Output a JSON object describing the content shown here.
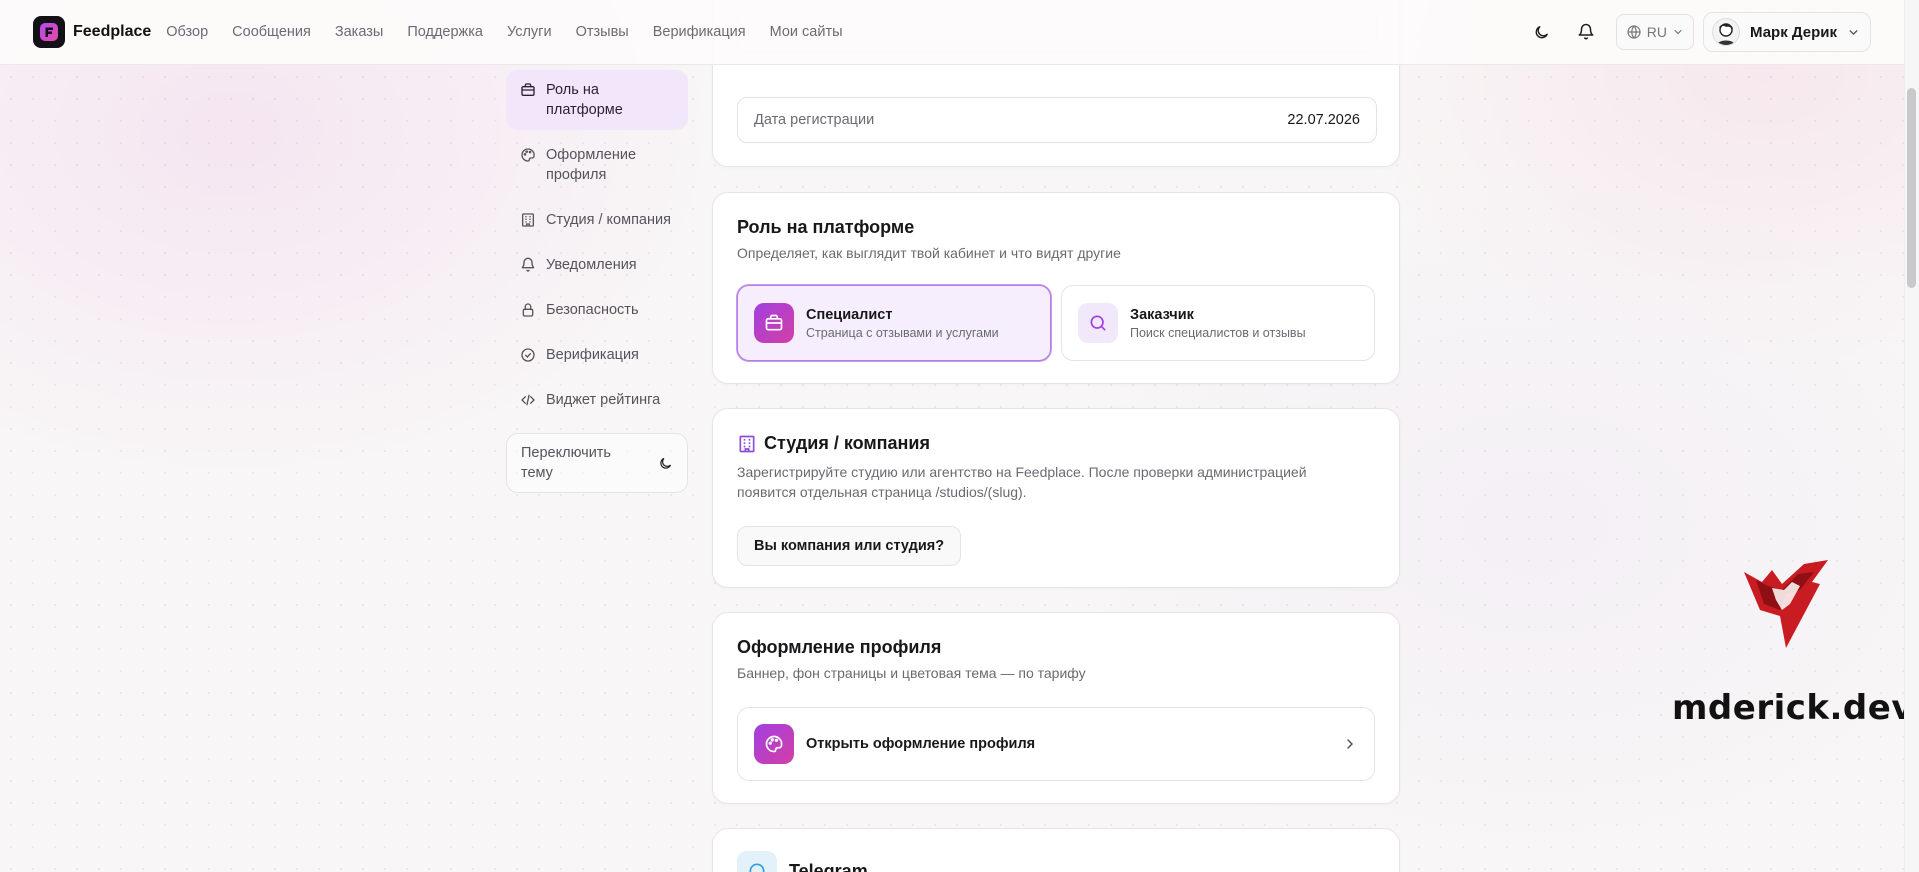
{
  "brand": {
    "name": "Feedplace"
  },
  "nav": [
    "Обзор",
    "Сообщения",
    "Заказы",
    "Поддержка",
    "Услуги",
    "Отзывы",
    "Верификация",
    "Мои сайты"
  ],
  "header": {
    "language": "RU",
    "user_name": "Марк Дерик"
  },
  "sidebar": {
    "items": [
      {
        "label": "Роль на платформе",
        "icon": "briefcase-icon",
        "active": true
      },
      {
        "label": "Оформление профиля",
        "icon": "palette-icon"
      },
      {
        "label": "Студия / компания",
        "icon": "building-icon"
      },
      {
        "label": "Уведомления",
        "icon": "bell-icon"
      },
      {
        "label": "Безопасность",
        "icon": "lock-icon"
      },
      {
        "label": "Верификация",
        "icon": "check-circle-icon"
      },
      {
        "label": "Виджет рейтинга",
        "icon": "code-icon"
      }
    ],
    "theme_toggle": "Переключить тему"
  },
  "account": {
    "reg_label": "Дата регистрации",
    "reg_date": "22.07.2026"
  },
  "role": {
    "title": "Роль на платформе",
    "subtitle": "Определяет, как выглядит твой кабинет и что видят другие",
    "options": [
      {
        "name": "Специалист",
        "desc": "Страница с отзывами и услугами",
        "selected": true
      },
      {
        "name": "Заказчик",
        "desc": "Поиск специалистов и отзывы",
        "selected": false
      }
    ]
  },
  "studio": {
    "title": "Студия / компания",
    "desc": "Зарегистрируйте студию или агентство на Feedplace. После проверки администрацией появится отдельная страница /studios/(slug).",
    "button": "Вы компания или студия?"
  },
  "design": {
    "title": "Оформление профиля",
    "subtitle": "Баннер, фон страницы и цветовая тема — по тарифу",
    "link": "Открыть оформление профиля"
  },
  "telegram": {
    "title": "Telegram"
  },
  "watermark": "mderick.dev",
  "colors": {
    "accent": "#a23fe0",
    "accent_pink": "#d33fa6",
    "selected_bg": "#f6eefc"
  }
}
